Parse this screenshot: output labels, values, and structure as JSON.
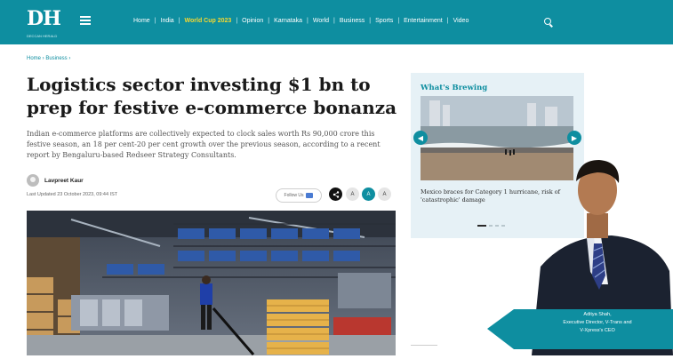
{
  "brand": {
    "logo_text": "DH",
    "logo_subtext": "DECCAN HERALD"
  },
  "nav": {
    "items": [
      {
        "label": "Home",
        "highlight": false
      },
      {
        "label": "India",
        "highlight": false
      },
      {
        "label": "World Cup 2023",
        "highlight": true
      },
      {
        "label": "Opinion",
        "highlight": false
      },
      {
        "label": "Karnataka",
        "highlight": false
      },
      {
        "label": "World",
        "highlight": false
      },
      {
        "label": "Business",
        "highlight": false
      },
      {
        "label": "Sports",
        "highlight": false
      },
      {
        "label": "Entertainment",
        "highlight": false
      },
      {
        "label": "Video",
        "highlight": false
      }
    ],
    "separator": "|",
    "search_icon": "search-icon",
    "menu_icon": "hamburger-menu-icon"
  },
  "breadcrumb": {
    "text": "Home › Business ›"
  },
  "article": {
    "headline": "Logistics sector investing $1 bn to prep for festive e-commerce bonanza",
    "summary": "Indian e-commerce platforms are collectively expected to clock sales worth Rs 90,000 crore this festive season, an 18 per cent-20 per cent growth over the previous season, according to a recent report by Bengaluru-based Redseer Strategy Consultants.",
    "author": "Lavpreet Kaur",
    "updated": "Last Updated 23 October 2023, 09:44 IST",
    "follow_label": "Follow Us",
    "share_icon": "share-icon",
    "font_sizes": [
      "A",
      "A",
      "A"
    ]
  },
  "sidebar": {
    "title": "What's Brewing",
    "headline": "Mexico braces for Category 1 hurricane, risk of 'catastrophic' damage",
    "prev_icon": "chevron-left-icon",
    "next_icon": "chevron-right-icon"
  },
  "ad": {
    "lines": [
      "Aditya Shah,",
      "Executive Director, V-Trans and",
      "V-Xpress's CEO"
    ]
  },
  "colors": {
    "brand": "#0e8ea0",
    "highlight": "#f6d830",
    "panel": "#e6f1f6"
  }
}
